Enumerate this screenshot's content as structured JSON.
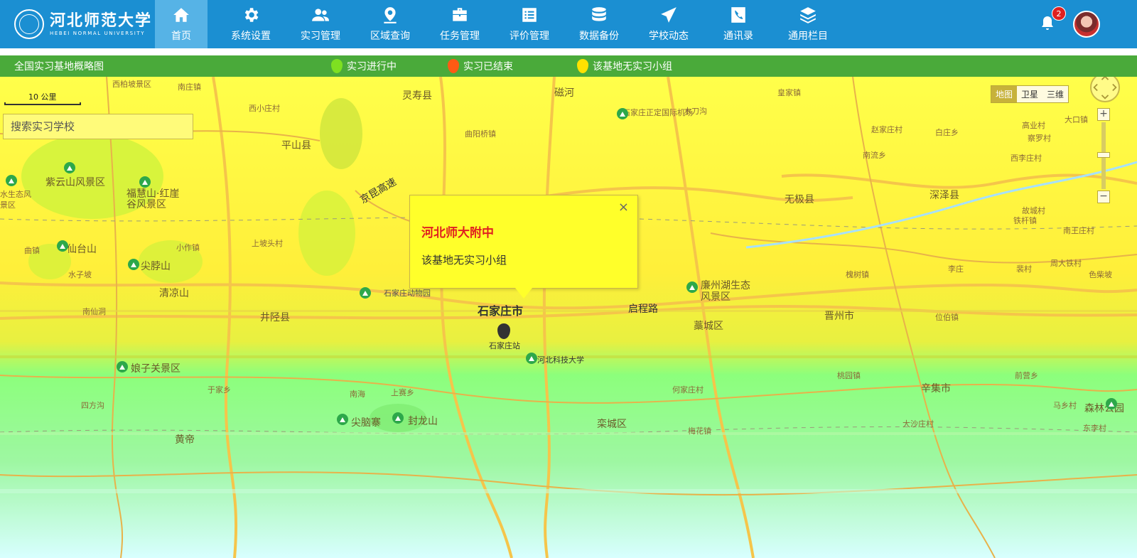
{
  "brand": {
    "name_cn": "河北师范大学",
    "name_en": "HEBEI NORMAL UNIVERSITY"
  },
  "nav": {
    "items": [
      {
        "label": "首页",
        "icon": "home-icon"
      },
      {
        "label": "系统设置",
        "icon": "gear-icon"
      },
      {
        "label": "实习管理",
        "icon": "users-icon"
      },
      {
        "label": "区域查询",
        "icon": "map-pin-icon"
      },
      {
        "label": "任务管理",
        "icon": "briefcase-icon"
      },
      {
        "label": "评价管理",
        "icon": "list-card-icon"
      },
      {
        "label": "数据备份",
        "icon": "database-icon"
      },
      {
        "label": "学校动态",
        "icon": "paper-plane-icon"
      },
      {
        "label": "通讯录",
        "icon": "phone-icon"
      },
      {
        "label": "通用栏目",
        "icon": "layers-icon"
      }
    ],
    "notifications_count": "2"
  },
  "legend": {
    "title": "全国实习基地概略图",
    "items": [
      {
        "label": "实习进行中",
        "color": "#7ee021"
      },
      {
        "label": "实习已结束",
        "color": "#ff5a14"
      },
      {
        "label": "该基地无实习小组",
        "color": "#ffe100"
      }
    ]
  },
  "map": {
    "scale_label": "10 公里",
    "search_placeholder": "搜索实习学校",
    "map_types": [
      "地图",
      "卫星",
      "三维"
    ],
    "active_map_type": "地图",
    "zoom_in": "+",
    "zoom_out": "−",
    "places": [
      {
        "name": "西柏坡景区"
      },
      {
        "name": "南庄镇"
      },
      {
        "name": "灵寿县"
      },
      {
        "name": "磁河"
      },
      {
        "name": "皇家镇"
      },
      {
        "name": "西小庄村"
      },
      {
        "name": "石家庄正定国际机场"
      },
      {
        "name": "木刀沟"
      },
      {
        "name": "大口镇"
      },
      {
        "name": "赵家庄村"
      },
      {
        "name": "高业村"
      },
      {
        "name": "平山县"
      },
      {
        "name": "曲阳桥镇"
      },
      {
        "name": "白庄乡"
      },
      {
        "name": "察罗村"
      },
      {
        "name": "南流乡"
      },
      {
        "name": "西李庄村"
      },
      {
        "name": "紫云山风景区"
      },
      {
        "name": "福慧山·红崖谷风景区"
      },
      {
        "name": "水生态风景区"
      },
      {
        "name": "京昆高速"
      },
      {
        "name": "无极县"
      },
      {
        "name": "深泽县"
      },
      {
        "name": "故城村"
      },
      {
        "name": "铁杆镇"
      },
      {
        "name": "南王庄村"
      },
      {
        "name": "仙台山"
      },
      {
        "name": "小作镇"
      },
      {
        "name": "上坡头村"
      },
      {
        "name": "曲镇"
      },
      {
        "name": "尖脖山"
      },
      {
        "name": "水子坡"
      },
      {
        "name": "清凉山"
      },
      {
        "name": "槐树镇"
      },
      {
        "name": "李庄"
      },
      {
        "name": "裴村"
      },
      {
        "name": "周大铁村"
      },
      {
        "name": "色柴坡"
      },
      {
        "name": "石家庄动物园"
      },
      {
        "name": "廉州湖生态风景区"
      },
      {
        "name": "南仙洞"
      },
      {
        "name": "井陉县"
      },
      {
        "name": "石家庄市"
      },
      {
        "name": "启程路"
      },
      {
        "name": "藁城区"
      },
      {
        "name": "晋州市"
      },
      {
        "name": "位伯镇"
      },
      {
        "name": "石家庄站"
      },
      {
        "name": "河北科技大学"
      },
      {
        "name": "娘子关景区"
      },
      {
        "name": "于家乡"
      },
      {
        "name": "南海"
      },
      {
        "name": "上赛乡"
      },
      {
        "name": "何家庄村"
      },
      {
        "name": "桃园镇"
      },
      {
        "name": "辛集市"
      },
      {
        "name": "前营乡"
      },
      {
        "name": "尖脑寨"
      },
      {
        "name": "封龙山"
      },
      {
        "name": "栾城区"
      },
      {
        "name": "梅花镇"
      },
      {
        "name": "大沙庄村"
      },
      {
        "name": "马乡村"
      },
      {
        "name": "森林公园"
      },
      {
        "name": "东李村"
      },
      {
        "name": "黄帝"
      },
      {
        "name": "四方沟"
      }
    ]
  },
  "info_window": {
    "title": "河北师大附中",
    "description": "该基地无实习小组",
    "close": "×"
  }
}
